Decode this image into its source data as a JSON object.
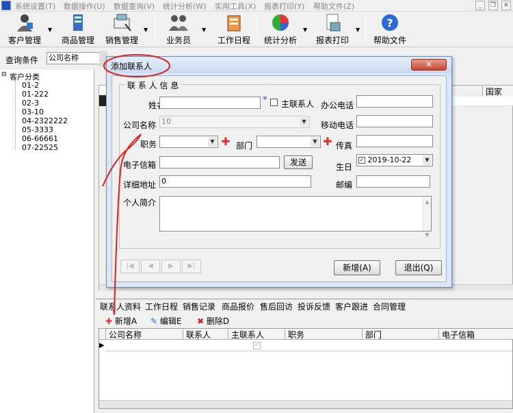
{
  "menubar": {
    "items": [
      "系统设置(T)",
      "数据操作(U)",
      "数据查询(V)",
      "统计分析(W)",
      "实用工具(X)",
      "报表打印(Y)",
      "帮助文件(Z)"
    ]
  },
  "toolbar": {
    "customer": "客户管理",
    "product": "商品管理",
    "sales": "销售管理",
    "salesman": "业务员",
    "schedule": "工作日程",
    "stats": "统计分析",
    "report": "报表打印",
    "help": "帮助文件"
  },
  "query": {
    "label": "查询条件",
    "field_value": "公司名称"
  },
  "tree": {
    "root": "客户分类",
    "children": [
      "01-2",
      "01-222",
      "02-3",
      "03-10",
      "04-2322222",
      "05-3333",
      "06-66661",
      "07-22525"
    ]
  },
  "mainpane": {
    "col_country": "国家"
  },
  "bottom_tabs": [
    "联系人资料",
    "工作日程",
    "销售记录",
    "商品报价",
    "售后回访",
    "投诉反馈",
    "客户跟进",
    "合同管理"
  ],
  "subbar": {
    "add": "新增A",
    "edit": "编辑E",
    "delete": "删除D"
  },
  "grid": {
    "columns": [
      "公司名称",
      "联系人",
      "主联系人",
      "职务",
      "部门",
      "电子信箱"
    ]
  },
  "dialog": {
    "title": "添加联系人",
    "close": "✕",
    "group_title": "联 系 人 信 息",
    "name_label": "姓名:",
    "required_mark": "*",
    "main_contact_label": "主联系人",
    "office_phone_label": "办公电话",
    "company_label": "公司名称",
    "company_value": "10",
    "mobile_label": "移动电话",
    "position_label": "职务",
    "dept_label": "部门",
    "fax_label": "传真",
    "email_label": "电子信箱",
    "send_button": "发送",
    "birthday_label": "生日",
    "birthday_value": "2019-10-22",
    "address_label": "详细地址",
    "address_value": "0",
    "zip_label": "邮编",
    "intro_label": "个人简介",
    "add_button": "新增(A)",
    "exit_button": "退出(Q)"
  },
  "colors": {
    "dialog_frame": "#dbe7f6",
    "close_red": "#c64a34",
    "annotation_red": "#e0201a"
  }
}
